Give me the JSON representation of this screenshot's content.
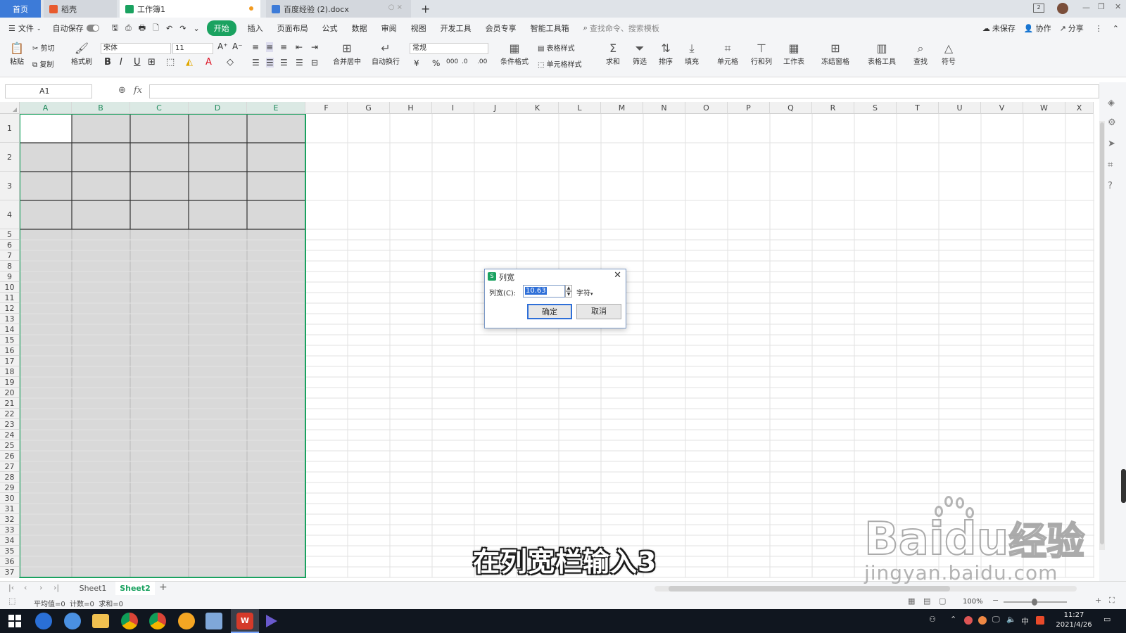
{
  "tabs": {
    "home": "首页",
    "docer": "稻壳",
    "workbook": "工作簿1",
    "doc": "百度经验 (2).docx",
    "add": "+"
  },
  "menu": {
    "file": "文件",
    "autosave": "自动保存",
    "start": "开始",
    "items": [
      "插入",
      "页面布局",
      "公式",
      "数据",
      "审阅",
      "视图",
      "开发工具",
      "会员专享",
      "智能工具箱"
    ],
    "search_placeholder": "查找命令、搜索模板",
    "unsaved": "未保存",
    "collab": "协作",
    "share": "分享"
  },
  "ribbon": {
    "paste": "粘贴",
    "cut": "剪切",
    "copy": "复制",
    "format_painter": "格式刷",
    "font": "宋体",
    "size": "11",
    "merge_center": "合并居中",
    "wrap": "自动换行",
    "number_format": "常规",
    "cond_format": "条件格式",
    "table_style": "表格样式",
    "cell_style": "单元格样式",
    "sum": "求和",
    "filter": "筛选",
    "sort": "排序",
    "fill": "填充",
    "cell": "单元格",
    "row_col": "行和列",
    "worksheet": "工作表",
    "freeze": "冻结窗格",
    "table_tools": "表格工具",
    "find": "查找",
    "symbol": "符号"
  },
  "formula_bar": {
    "name_box": "A1",
    "fx": "fx",
    "content": ""
  },
  "columns": [
    "A",
    "B",
    "C",
    "D",
    "E",
    "F",
    "G",
    "H",
    "I",
    "J",
    "K",
    "L",
    "M",
    "N",
    "O",
    "P",
    "Q",
    "R",
    "S",
    "T",
    "U",
    "V",
    "W",
    "X"
  ],
  "rows": [
    "1",
    "2",
    "3",
    "4",
    "5",
    "6",
    "7",
    "8",
    "9",
    "10",
    "11",
    "12",
    "13",
    "14",
    "15",
    "16",
    "17",
    "18",
    "19",
    "20",
    "21",
    "22",
    "23",
    "24",
    "25",
    "26",
    "27",
    "28",
    "29",
    "30",
    "31",
    "32",
    "33",
    "34",
    "35",
    "36",
    "37"
  ],
  "sheets": {
    "sheet1": "Sheet1",
    "sheet2": "Sheet2",
    "add": "+"
  },
  "status": {
    "summary": "平均值=0  计数=0  求和=0",
    "zoom": "100%"
  },
  "dialog": {
    "title": "列宽",
    "label": "列宽(C):",
    "value": "10.63",
    "unit": "字符",
    "ok": "确定",
    "cancel": "取消"
  },
  "caption": "在列宽栏输入3",
  "watermark": {
    "brand_en": "Baidu",
    "brand_cn": "经验",
    "url": "jingyan.baidu.com"
  },
  "taskbar": {
    "time": "11:27",
    "date": "2021/4/26",
    "ime": "中"
  },
  "colors": {
    "accent": "#1aa260",
    "selection_fill": "#d9d9d9",
    "taskbar": "#10161f"
  }
}
